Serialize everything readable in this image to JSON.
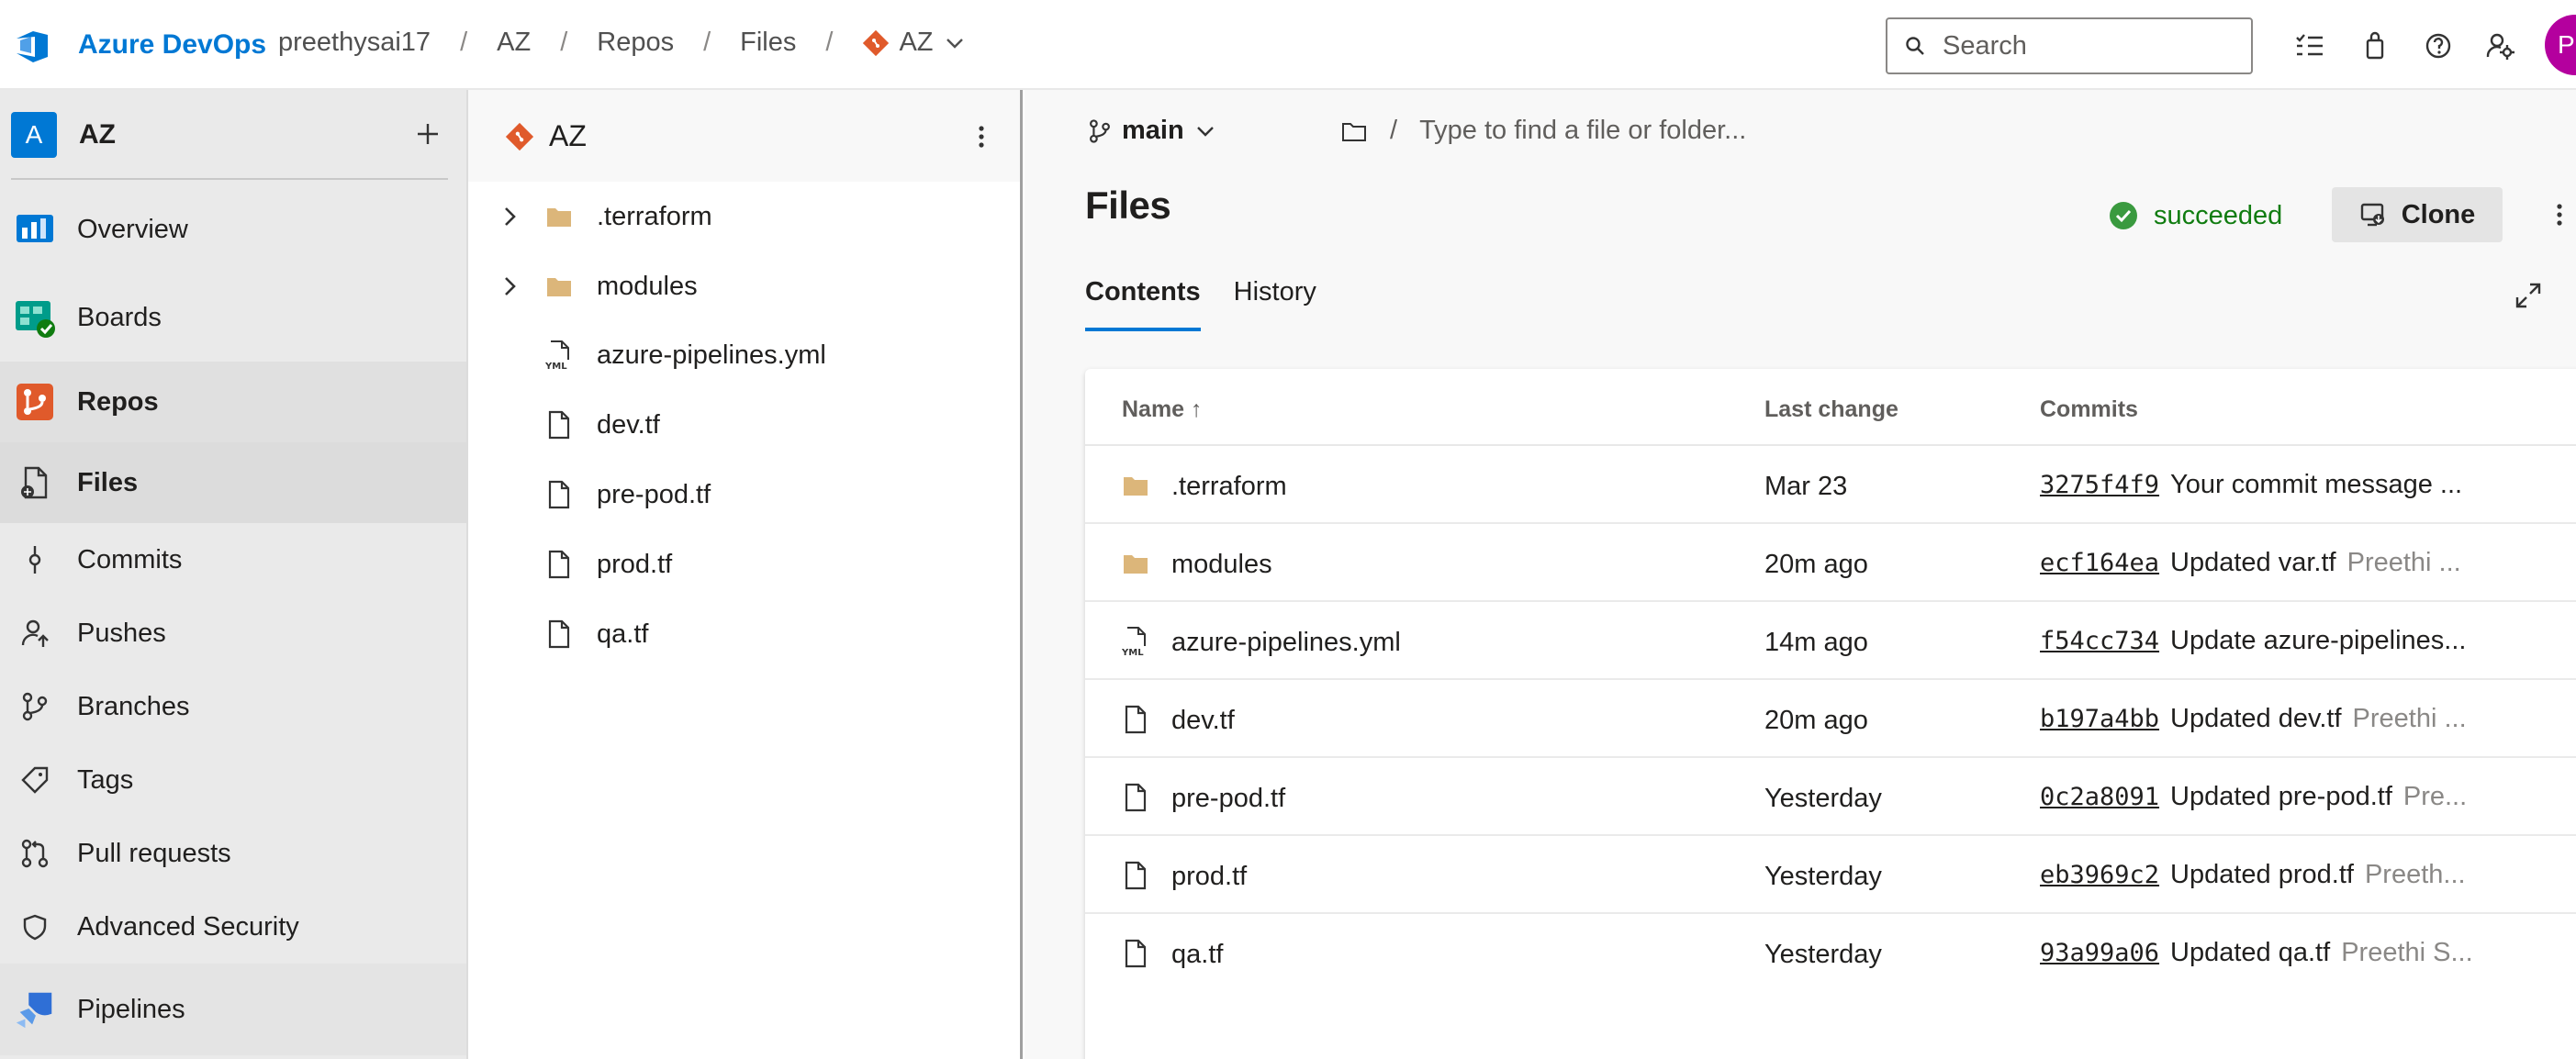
{
  "app": {
    "brand": "Azure DevOps",
    "accent": "#0078d4"
  },
  "breadcrumb": [
    "preethysai17",
    "AZ",
    "Repos",
    "Files",
    "AZ"
  ],
  "search": {
    "placeholder": "Search"
  },
  "user": {
    "avatar_initial": "P",
    "avatar_color": "#b4009e"
  },
  "project": {
    "initial": "A",
    "name": "AZ"
  },
  "nav": {
    "overview": "Overview",
    "boards": "Boards",
    "repos": "Repos",
    "files": "Files",
    "commits": "Commits",
    "pushes": "Pushes",
    "branches": "Branches",
    "tags": "Tags",
    "pull_requests": "Pull requests",
    "advanced_security": "Advanced Security",
    "pipelines": "Pipelines"
  },
  "tree": {
    "repo_name": "AZ",
    "items": [
      {
        "name": ".terraform",
        "type": "folder"
      },
      {
        "name": "modules",
        "type": "folder"
      },
      {
        "name": "azure-pipelines.yml",
        "type": "yml"
      },
      {
        "name": "dev.tf",
        "type": "file"
      },
      {
        "name": "pre-pod.tf",
        "type": "file"
      },
      {
        "name": "prod.tf",
        "type": "file"
      },
      {
        "name": "qa.tf",
        "type": "file"
      }
    ]
  },
  "main": {
    "branch": "main",
    "path_separator": "/",
    "path_placeholder": "Type to find a file or folder...",
    "title": "Files",
    "status": "succeeded",
    "clone_label": "Clone",
    "tabs": [
      "Contents",
      "History"
    ],
    "columns": {
      "name": "Name ↑",
      "last_change": "Last change",
      "commits": "Commits"
    },
    "rows": [
      {
        "name": ".terraform",
        "type": "folder",
        "last_change": "Mar 23",
        "hash": "3275f4f9",
        "message": "Your commit message ...",
        "author": ""
      },
      {
        "name": "modules",
        "type": "folder",
        "last_change": "20m ago",
        "hash": "ecf164ea",
        "message": "Updated var.tf",
        "author": "Preethi ..."
      },
      {
        "name": "azure-pipelines.yml",
        "type": "yml",
        "last_change": "14m ago",
        "hash": "f54cc734",
        "message": "Update azure-pipelines...",
        "author": ""
      },
      {
        "name": "dev.tf",
        "type": "file",
        "last_change": "20m ago",
        "hash": "b197a4bb",
        "message": "Updated dev.tf",
        "author": "Preethi ..."
      },
      {
        "name": "pre-pod.tf",
        "type": "file",
        "last_change": "Yesterday",
        "hash": "0c2a8091",
        "message": "Updated pre-pod.tf",
        "author": "Pre..."
      },
      {
        "name": "prod.tf",
        "type": "file",
        "last_change": "Yesterday",
        "hash": "eb3969c2",
        "message": "Updated prod.tf",
        "author": "Preeth..."
      },
      {
        "name": "qa.tf",
        "type": "file",
        "last_change": "Yesterday",
        "hash": "93a99a06",
        "message": "Updated qa.tf",
        "author": "Preethi S..."
      }
    ]
  }
}
